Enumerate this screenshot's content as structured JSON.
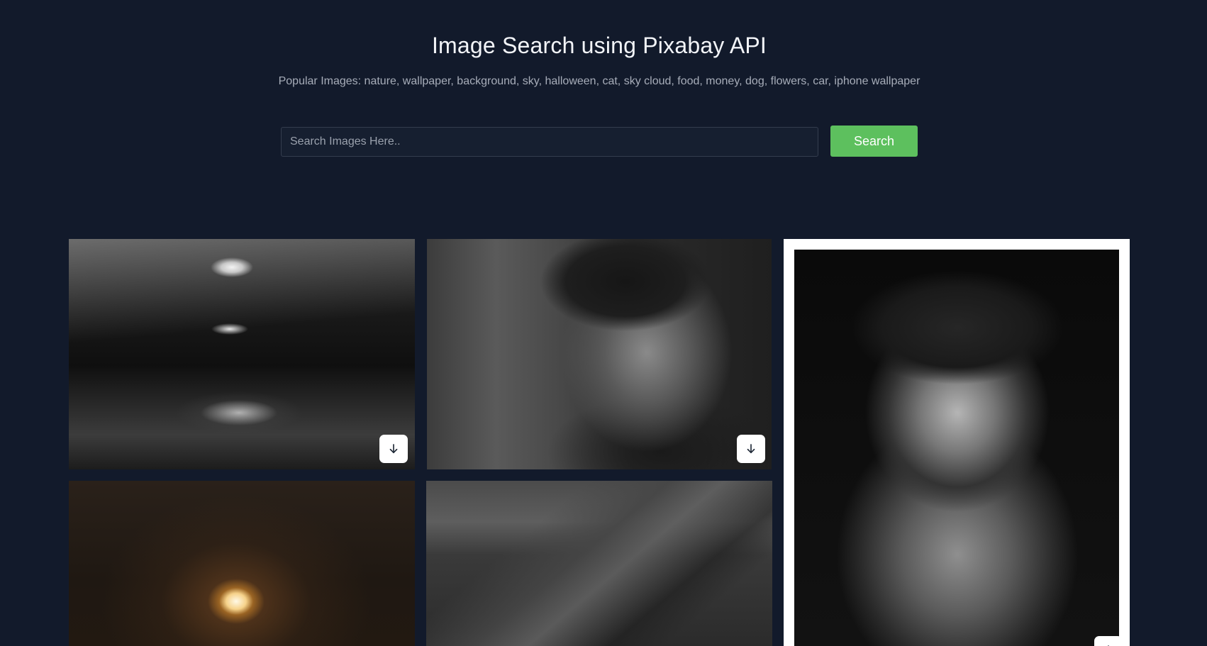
{
  "header": {
    "title": "Image Search using Pixabay API",
    "popular_text": "Popular Images: nature, wallpaper, background, sky, halloween, cat, sky cloud, food, money, dog, flowers, car, iphone wallpaper"
  },
  "search": {
    "placeholder": "Search Images Here..",
    "value": "",
    "button_label": "Search"
  },
  "results": [
    {
      "subject": "dark empty corridor with a chair",
      "icon": "download-icon"
    },
    {
      "subject": "elderly man in a knit cap",
      "icon": "download-icon"
    },
    {
      "subject": "bearded man portrait",
      "icon": "download-icon"
    },
    {
      "subject": "glowing lantern",
      "icon": "download-icon"
    },
    {
      "subject": "man sleeping on the ground",
      "icon": "download-icon"
    }
  ],
  "colors": {
    "background": "#121a2b",
    "accent": "#5dc05e",
    "title": "#f2f4f8",
    "muted_text": "#a7adb9"
  }
}
